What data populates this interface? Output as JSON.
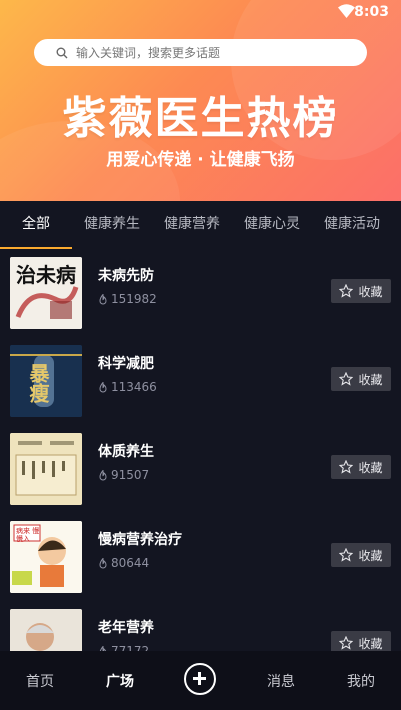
{
  "status": {
    "time": "8:03"
  },
  "search": {
    "placeholder": "输入关键词，搜索更多话题"
  },
  "hero": {
    "title": "紫薇医生热榜",
    "subtitle": "用爱心传递 · 让健康飞扬"
  },
  "tabs": [
    "全部",
    "健康养生",
    "健康营养",
    "健康心灵",
    "健康活动"
  ],
  "items": [
    {
      "title": "未病先防",
      "count": "151982",
      "fav_label": "收藏",
      "thumb_text": "治未病"
    },
    {
      "title": "科学减肥",
      "count": "113466",
      "fav_label": "收藏",
      "thumb_text": "暴瘦"
    },
    {
      "title": "体质养生",
      "count": "91507",
      "fav_label": "收藏",
      "thumb_text": ""
    },
    {
      "title": "慢病营养治疗",
      "count": "80644",
      "fav_label": "收藏",
      "thumb_text": "病来 慢慢入"
    },
    {
      "title": "老年营养",
      "count": "77172",
      "fav_label": "收藏",
      "thumb_text": ""
    }
  ],
  "nav": [
    "首页",
    "广场",
    "消息",
    "我的"
  ],
  "colors": {
    "hero_start": "#fdb84a",
    "hero_end": "#fc6f69",
    "tab_indicator": "#fbaa2f",
    "background": "#131521"
  }
}
